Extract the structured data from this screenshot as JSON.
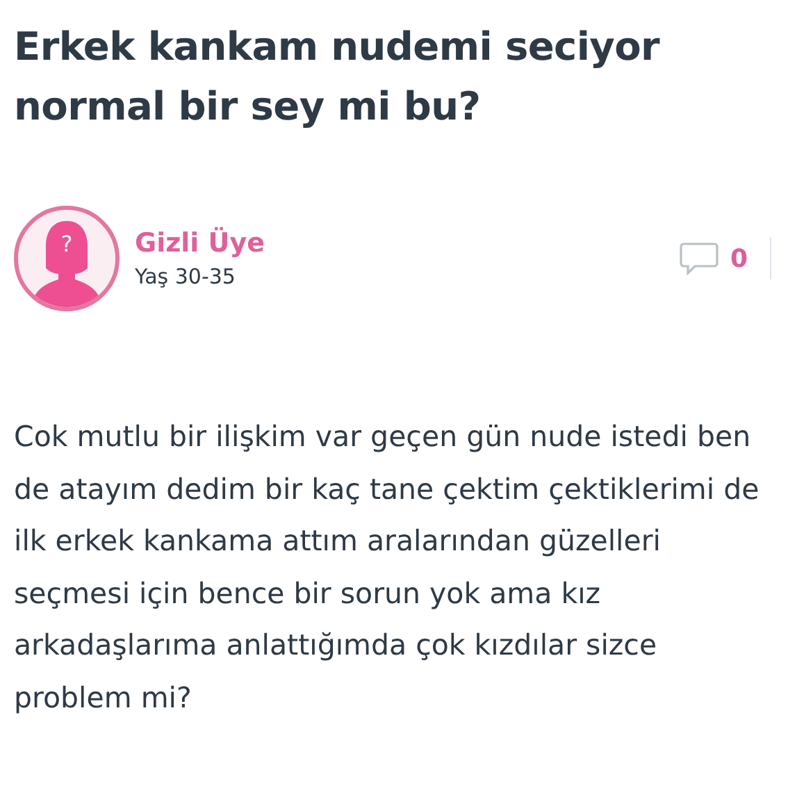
{
  "question": {
    "title": "Erkek kankam nudemi seciyor normal bir sey mi bu?"
  },
  "author": {
    "avatar_mark": "?",
    "name": "Gizli Üye",
    "age": "Yaş 30-35"
  },
  "stats": {
    "comments": "0"
  },
  "body": "Cok mutlu bir ilişkim var geçen gün nude istedi ben de atayım dedim bir kaç tane çektim çektiklerimi de ilk erkek kankama attım aralarından güzelleri seçmesi için bence bir sorun yok ama kız arkadaşlarıma anlattığımda çok kızdılar sizce problem mi?"
}
